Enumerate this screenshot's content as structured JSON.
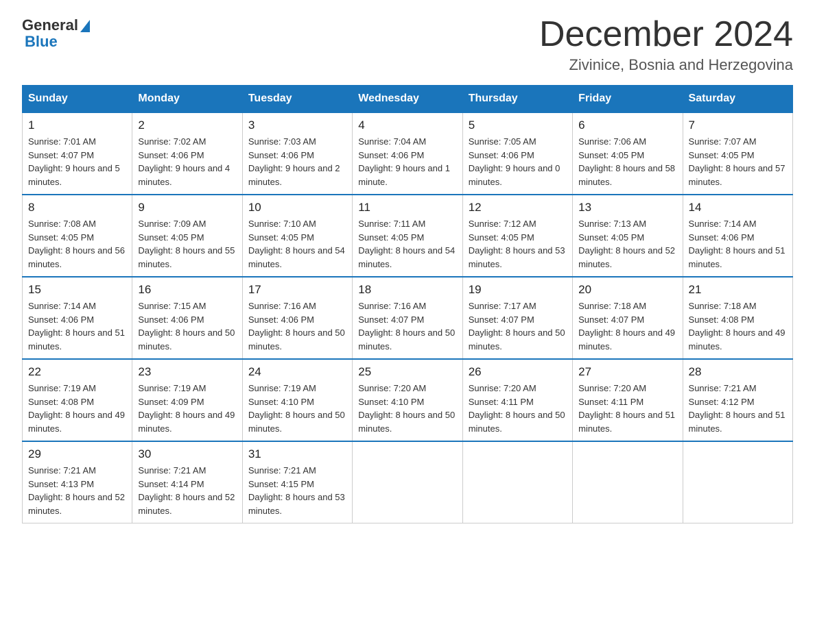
{
  "logo": {
    "general": "General",
    "blue": "Blue"
  },
  "title": "December 2024",
  "location": "Zivinice, Bosnia and Herzegovina",
  "headers": [
    "Sunday",
    "Monday",
    "Tuesday",
    "Wednesday",
    "Thursday",
    "Friday",
    "Saturday"
  ],
  "weeks": [
    [
      {
        "day": "1",
        "sunrise": "7:01 AM",
        "sunset": "4:07 PM",
        "daylight": "9 hours and 5 minutes."
      },
      {
        "day": "2",
        "sunrise": "7:02 AM",
        "sunset": "4:06 PM",
        "daylight": "9 hours and 4 minutes."
      },
      {
        "day": "3",
        "sunrise": "7:03 AM",
        "sunset": "4:06 PM",
        "daylight": "9 hours and 2 minutes."
      },
      {
        "day": "4",
        "sunrise": "7:04 AM",
        "sunset": "4:06 PM",
        "daylight": "9 hours and 1 minute."
      },
      {
        "day": "5",
        "sunrise": "7:05 AM",
        "sunset": "4:06 PM",
        "daylight": "9 hours and 0 minutes."
      },
      {
        "day": "6",
        "sunrise": "7:06 AM",
        "sunset": "4:05 PM",
        "daylight": "8 hours and 58 minutes."
      },
      {
        "day": "7",
        "sunrise": "7:07 AM",
        "sunset": "4:05 PM",
        "daylight": "8 hours and 57 minutes."
      }
    ],
    [
      {
        "day": "8",
        "sunrise": "7:08 AM",
        "sunset": "4:05 PM",
        "daylight": "8 hours and 56 minutes."
      },
      {
        "day": "9",
        "sunrise": "7:09 AM",
        "sunset": "4:05 PM",
        "daylight": "8 hours and 55 minutes."
      },
      {
        "day": "10",
        "sunrise": "7:10 AM",
        "sunset": "4:05 PM",
        "daylight": "8 hours and 54 minutes."
      },
      {
        "day": "11",
        "sunrise": "7:11 AM",
        "sunset": "4:05 PM",
        "daylight": "8 hours and 54 minutes."
      },
      {
        "day": "12",
        "sunrise": "7:12 AM",
        "sunset": "4:05 PM",
        "daylight": "8 hours and 53 minutes."
      },
      {
        "day": "13",
        "sunrise": "7:13 AM",
        "sunset": "4:05 PM",
        "daylight": "8 hours and 52 minutes."
      },
      {
        "day": "14",
        "sunrise": "7:14 AM",
        "sunset": "4:06 PM",
        "daylight": "8 hours and 51 minutes."
      }
    ],
    [
      {
        "day": "15",
        "sunrise": "7:14 AM",
        "sunset": "4:06 PM",
        "daylight": "8 hours and 51 minutes."
      },
      {
        "day": "16",
        "sunrise": "7:15 AM",
        "sunset": "4:06 PM",
        "daylight": "8 hours and 50 minutes."
      },
      {
        "day": "17",
        "sunrise": "7:16 AM",
        "sunset": "4:06 PM",
        "daylight": "8 hours and 50 minutes."
      },
      {
        "day": "18",
        "sunrise": "7:16 AM",
        "sunset": "4:07 PM",
        "daylight": "8 hours and 50 minutes."
      },
      {
        "day": "19",
        "sunrise": "7:17 AM",
        "sunset": "4:07 PM",
        "daylight": "8 hours and 50 minutes."
      },
      {
        "day": "20",
        "sunrise": "7:18 AM",
        "sunset": "4:07 PM",
        "daylight": "8 hours and 49 minutes."
      },
      {
        "day": "21",
        "sunrise": "7:18 AM",
        "sunset": "4:08 PM",
        "daylight": "8 hours and 49 minutes."
      }
    ],
    [
      {
        "day": "22",
        "sunrise": "7:19 AM",
        "sunset": "4:08 PM",
        "daylight": "8 hours and 49 minutes."
      },
      {
        "day": "23",
        "sunrise": "7:19 AM",
        "sunset": "4:09 PM",
        "daylight": "8 hours and 49 minutes."
      },
      {
        "day": "24",
        "sunrise": "7:19 AM",
        "sunset": "4:10 PM",
        "daylight": "8 hours and 50 minutes."
      },
      {
        "day": "25",
        "sunrise": "7:20 AM",
        "sunset": "4:10 PM",
        "daylight": "8 hours and 50 minutes."
      },
      {
        "day": "26",
        "sunrise": "7:20 AM",
        "sunset": "4:11 PM",
        "daylight": "8 hours and 50 minutes."
      },
      {
        "day": "27",
        "sunrise": "7:20 AM",
        "sunset": "4:11 PM",
        "daylight": "8 hours and 51 minutes."
      },
      {
        "day": "28",
        "sunrise": "7:21 AM",
        "sunset": "4:12 PM",
        "daylight": "8 hours and 51 minutes."
      }
    ],
    [
      {
        "day": "29",
        "sunrise": "7:21 AM",
        "sunset": "4:13 PM",
        "daylight": "8 hours and 52 minutes."
      },
      {
        "day": "30",
        "sunrise": "7:21 AM",
        "sunset": "4:14 PM",
        "daylight": "8 hours and 52 minutes."
      },
      {
        "day": "31",
        "sunrise": "7:21 AM",
        "sunset": "4:15 PM",
        "daylight": "8 hours and 53 minutes."
      },
      null,
      null,
      null,
      null
    ]
  ],
  "labels": {
    "sunrise": "Sunrise: ",
    "sunset": "Sunset: ",
    "daylight": "Daylight: "
  }
}
